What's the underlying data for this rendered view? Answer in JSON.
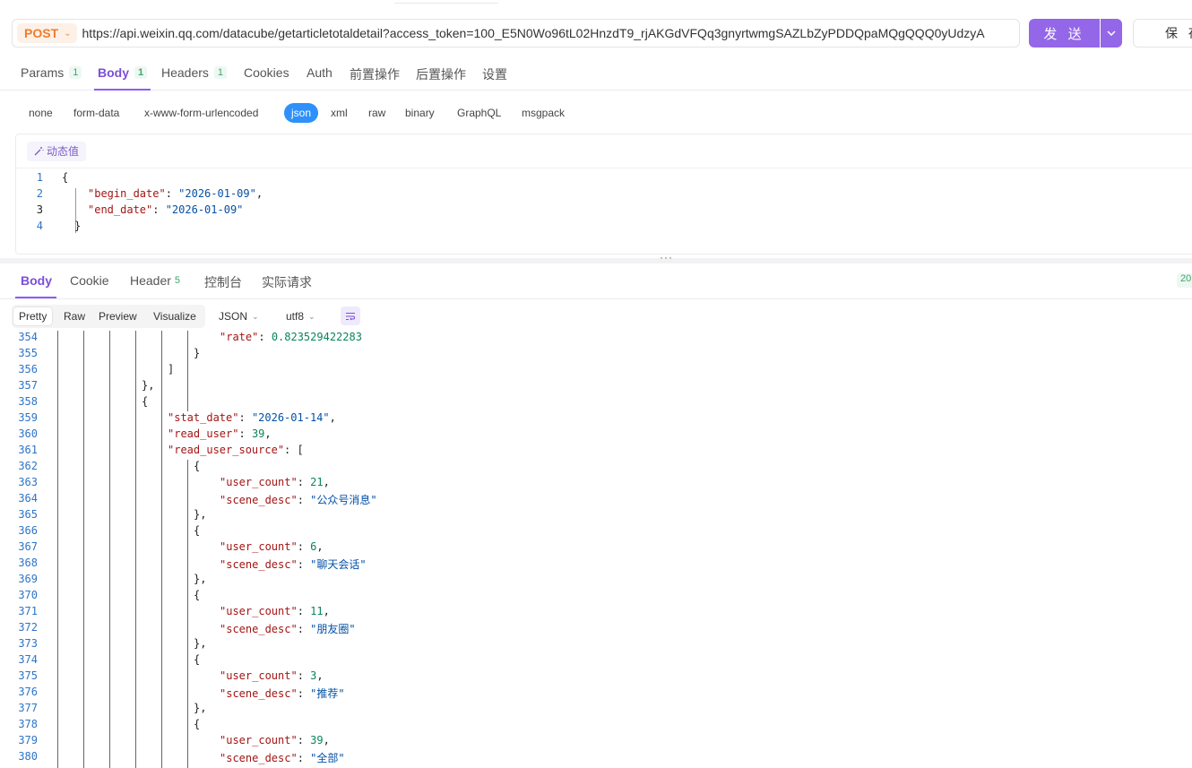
{
  "request": {
    "method": "POST",
    "url": "https://api.weixin.qq.com/datacube/getarticletotaldetail?access_token=100_E5N0Wo96tL02HnzdT9_rjAKGdVFQq3gnyrtwmgSAZLbZyPDDQpaMQgQQQ0yUdzyA",
    "send_label": "发 送",
    "save_label": "保 存"
  },
  "request_tabs": [
    {
      "label": "Params",
      "badge": "1"
    },
    {
      "label": "Body",
      "badge": "1"
    },
    {
      "label": "Headers",
      "badge": "1"
    },
    {
      "label": "Cookies",
      "badge": ""
    },
    {
      "label": "Auth",
      "badge": ""
    },
    {
      "label": "前置操作",
      "badge": ""
    },
    {
      "label": "后置操作",
      "badge": ""
    },
    {
      "label": "设置",
      "badge": ""
    }
  ],
  "body_types": [
    "none",
    "form-data",
    "x-www-form-urlencoded",
    "json",
    "xml",
    "raw",
    "binary",
    "GraphQL",
    "msgpack"
  ],
  "body_type_selected": "json",
  "editor": {
    "dynamic_label": "动态值",
    "line_numbers": [
      "1",
      "2",
      "3",
      "4"
    ],
    "lines": [
      {
        "text": "{"
      },
      {
        "key": "\"begin_date\"",
        "value": "\"2026-01-09\"",
        "trail": ","
      },
      {
        "key": "\"end_date\"",
        "value": "\"2026-01-09\"",
        "trail": ""
      },
      {
        "text": "}"
      }
    ]
  },
  "response_tabs": [
    {
      "label": "Body",
      "badge": ""
    },
    {
      "label": "Cookie",
      "badge": ""
    },
    {
      "label": "Header",
      "badge": "5"
    },
    {
      "label": "控制台",
      "badge": ""
    },
    {
      "label": "实际请求",
      "badge": ""
    }
  ],
  "status_code": "20",
  "view_modes": [
    "Pretty",
    "Raw",
    "Preview",
    "Visualize"
  ],
  "format": "JSON",
  "encoding": "utf8",
  "response_lines": [
    {
      "n": "354",
      "indent": 8,
      "parts": [
        [
          "k",
          "\"rate\""
        ],
        [
          "p",
          ": "
        ],
        [
          "n",
          "0.823529422283"
        ]
      ]
    },
    {
      "n": "355",
      "indent": 7,
      "parts": [
        [
          "p",
          "}"
        ]
      ]
    },
    {
      "n": "356",
      "indent": 6,
      "parts": [
        [
          "p",
          "]"
        ]
      ]
    },
    {
      "n": "357",
      "indent": 5,
      "parts": [
        [
          "p",
          "},"
        ]
      ]
    },
    {
      "n": "358",
      "indent": 5,
      "parts": [
        [
          "p",
          "{"
        ]
      ]
    },
    {
      "n": "359",
      "indent": 6,
      "parts": [
        [
          "k",
          "\"stat_date\""
        ],
        [
          "p",
          ": "
        ],
        [
          "s",
          "\"2026-01-14\""
        ],
        [
          "p",
          ","
        ]
      ]
    },
    {
      "n": "360",
      "indent": 6,
      "parts": [
        [
          "k",
          "\"read_user\""
        ],
        [
          "p",
          ": "
        ],
        [
          "n",
          "39"
        ],
        [
          "p",
          ","
        ]
      ]
    },
    {
      "n": "361",
      "indent": 6,
      "parts": [
        [
          "k",
          "\"read_user_source\""
        ],
        [
          "p",
          ": ["
        ]
      ]
    },
    {
      "n": "362",
      "indent": 7,
      "parts": [
        [
          "p",
          "{"
        ]
      ]
    },
    {
      "n": "363",
      "indent": 8,
      "parts": [
        [
          "k",
          "\"user_count\""
        ],
        [
          "p",
          ": "
        ],
        [
          "n",
          "21"
        ],
        [
          "p",
          ","
        ]
      ]
    },
    {
      "n": "364",
      "indent": 8,
      "parts": [
        [
          "k",
          "\"scene_desc\""
        ],
        [
          "p",
          ": "
        ],
        [
          "s",
          "\"公众号消息\""
        ]
      ]
    },
    {
      "n": "365",
      "indent": 7,
      "parts": [
        [
          "p",
          "},"
        ]
      ]
    },
    {
      "n": "366",
      "indent": 7,
      "parts": [
        [
          "p",
          "{"
        ]
      ]
    },
    {
      "n": "367",
      "indent": 8,
      "parts": [
        [
          "k",
          "\"user_count\""
        ],
        [
          "p",
          ": "
        ],
        [
          "n",
          "6"
        ],
        [
          "p",
          ","
        ]
      ]
    },
    {
      "n": "368",
      "indent": 8,
      "parts": [
        [
          "k",
          "\"scene_desc\""
        ],
        [
          "p",
          ": "
        ],
        [
          "s",
          "\"聊天会话\""
        ]
      ]
    },
    {
      "n": "369",
      "indent": 7,
      "parts": [
        [
          "p",
          "},"
        ]
      ]
    },
    {
      "n": "370",
      "indent": 7,
      "parts": [
        [
          "p",
          "{"
        ]
      ]
    },
    {
      "n": "371",
      "indent": 8,
      "parts": [
        [
          "k",
          "\"user_count\""
        ],
        [
          "p",
          ": "
        ],
        [
          "n",
          "11"
        ],
        [
          "p",
          ","
        ]
      ]
    },
    {
      "n": "372",
      "indent": 8,
      "parts": [
        [
          "k",
          "\"scene_desc\""
        ],
        [
          "p",
          ": "
        ],
        [
          "s",
          "\"朋友圈\""
        ]
      ]
    },
    {
      "n": "373",
      "indent": 7,
      "parts": [
        [
          "p",
          "},"
        ]
      ]
    },
    {
      "n": "374",
      "indent": 7,
      "parts": [
        [
          "p",
          "{"
        ]
      ]
    },
    {
      "n": "375",
      "indent": 8,
      "parts": [
        [
          "k",
          "\"user_count\""
        ],
        [
          "p",
          ": "
        ],
        [
          "n",
          "3"
        ],
        [
          "p",
          ","
        ]
      ]
    },
    {
      "n": "376",
      "indent": 8,
      "parts": [
        [
          "k",
          "\"scene_desc\""
        ],
        [
          "p",
          ": "
        ],
        [
          "s",
          "\"推荐\""
        ]
      ]
    },
    {
      "n": "377",
      "indent": 7,
      "parts": [
        [
          "p",
          "},"
        ]
      ]
    },
    {
      "n": "378",
      "indent": 7,
      "parts": [
        [
          "p",
          "{"
        ]
      ]
    },
    {
      "n": "379",
      "indent": 8,
      "parts": [
        [
          "k",
          "\"user_count\""
        ],
        [
          "p",
          ": "
        ],
        [
          "n",
          "39"
        ],
        [
          "p",
          ","
        ]
      ]
    },
    {
      "n": "380",
      "indent": 8,
      "parts": [
        [
          "k",
          "\"scene_desc\""
        ],
        [
          "p",
          ": "
        ],
        [
          "s",
          "\"全部\""
        ]
      ]
    }
  ]
}
